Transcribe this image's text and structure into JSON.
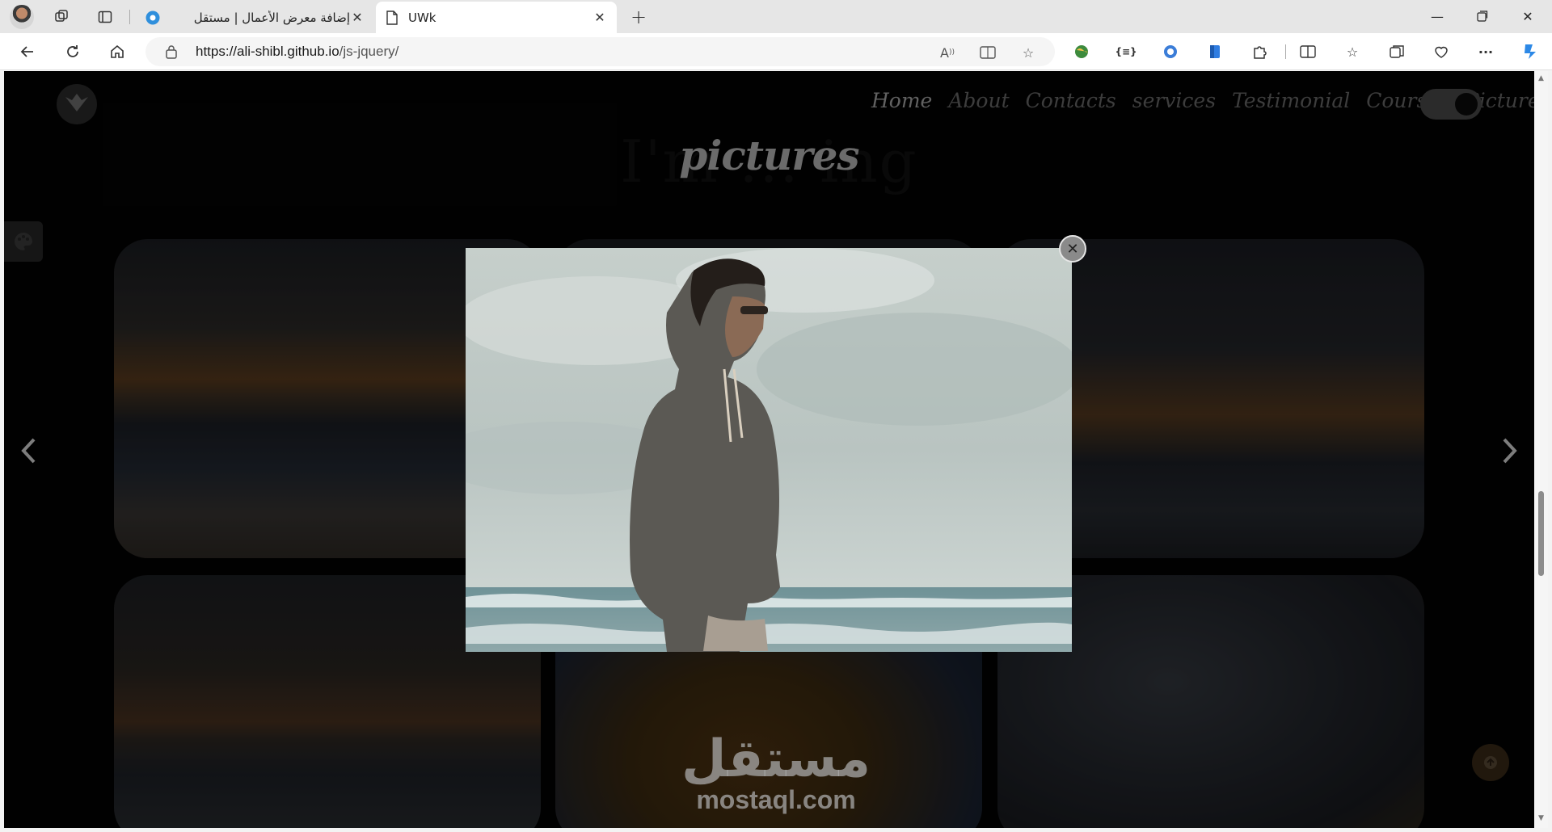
{
  "browser": {
    "tabs": [
      {
        "title": "إضافة معرض الأعمال | مستقل",
        "active": false
      },
      {
        "title": "UWk",
        "active": true
      }
    ],
    "new_tab_icon": "plus-icon",
    "url_host": "https://ali-shibl.github.io",
    "url_path": "/js-jquery/",
    "window_controls": [
      "minimize-icon",
      "restore-icon",
      "close-icon"
    ]
  },
  "page": {
    "nav_items": [
      "Home",
      "About",
      "Contacts",
      "services",
      "Testimonial",
      "Courses",
      "Pictures"
    ],
    "active_nav": "Home",
    "section_title": "pictures",
    "background_text": "I'm ... ing",
    "theme_toggle": "dark",
    "colors": {
      "page_background": "#030303",
      "nav_text": "#6a6a6a",
      "accent_button": "#3a2a18"
    }
  },
  "lightbox": {
    "open": true,
    "close_icon": "close-icon",
    "image_subject": "man in grey hoodie and sunglasses at beach"
  },
  "carousel": {
    "prev_icon": "chevron-left-icon",
    "next_icon": "chevron-right-icon"
  },
  "watermark": {
    "arabic": "مستقل",
    "latin": "mostaql.com"
  }
}
